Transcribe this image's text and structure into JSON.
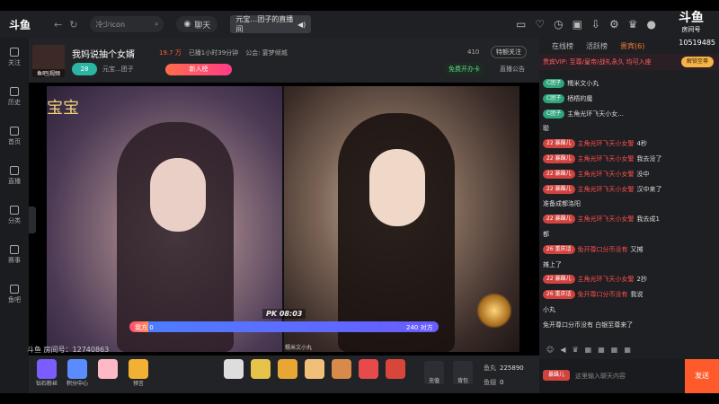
{
  "topbar": {
    "logo": "斗鱼",
    "search_placeholder": "冷少icon",
    "chat_label": "聊天",
    "tab_label": "元宝…团子的直播间",
    "brand": "斗鱼",
    "brand_sub": "房间号",
    "room_number": "10519485"
  },
  "sidebar": {
    "items": [
      {
        "label": "关注",
        "icon": "plus-icon"
      },
      {
        "label": "历史",
        "icon": "clock-icon"
      },
      {
        "label": "首页",
        "icon": "home-icon"
      },
      {
        "label": "直播",
        "icon": "tv-icon"
      },
      {
        "label": "分类",
        "icon": "grid-icon"
      },
      {
        "label": "赛事",
        "icon": "trophy-icon"
      },
      {
        "label": "鱼吧",
        "icon": "bubble-icon"
      }
    ]
  },
  "room": {
    "avatar_caption": "鱼吧|视频",
    "title": "我妈说抽个女婿",
    "hot": "19.7 万",
    "duration": "已播1小时39分钟",
    "notice_meta": "公会: 宴梦倾城",
    "level": "28",
    "host": "元宝...团子",
    "new_rank": "新人榜",
    "count": "410",
    "follow": "特额关注",
    "free_card": "免费开办卡",
    "announcement": "直播公告"
  },
  "video": {
    "overlay_text": "宝宝",
    "pk_label": "PK",
    "pk_time": "08:03",
    "our_side": "我方 0",
    "their_side": "240 对方",
    "our_fraction": 0.06,
    "right_name": "糯米文小丸",
    "douyu_id": "斗鱼 房间号：12740863"
  },
  "gifts": {
    "left": [
      {
        "label": "钻石粉丝",
        "color": "#7a5cff"
      },
      {
        "label": "积分中心",
        "color": "#5b8cff"
      },
      {
        "label": "",
        "color": "#ffb8c6"
      },
      {
        "label": "预言",
        "color": "#f2b134"
      }
    ],
    "middle": [
      {
        "label": "",
        "color": "#dddddd"
      },
      {
        "label": "",
        "color": "#e6c34a"
      },
      {
        "label": "",
        "color": "#e8a735"
      },
      {
        "label": "",
        "color": "#f0c07a"
      },
      {
        "label": "",
        "color": "#d88a4a"
      },
      {
        "label": "",
        "color": "#e64a4a"
      },
      {
        "label": "",
        "color": "#d8453a"
      }
    ],
    "recharge": "充值",
    "backpack": "背包",
    "fish_pill_label": "鱼丸",
    "fish_pill_value": "225890",
    "fish_fin_label": "鱼翅",
    "fish_fin_value": "0"
  },
  "chat": {
    "tabs": [
      "在线榜",
      "活跃榜",
      "贵宾(6)"
    ],
    "vip_banner": "贵宾VIP: 至尊/皇帝/战礼永久 均可入座",
    "unlock": "解锁至尊",
    "messages": [
      {
        "badge": "C团子",
        "text": "糯米文小丸"
      },
      {
        "badge": "C团子",
        "text": "栖梧的魔"
      },
      {
        "badge": "C团子",
        "text": "主角光环飞天小女..."
      },
      {
        "badge": "",
        "text": "聪"
      },
      {
        "badge": "22 暴躁儿",
        "text": "4秒",
        "name": "主角光环飞天小女警"
      },
      {
        "badge": "22 暴躁儿",
        "text": "我去没了",
        "name": "主角光环飞天小女警"
      },
      {
        "badge": "22 暴躁儿",
        "text": "没中",
        "name": "主角光环飞天小女警"
      },
      {
        "badge": "22 暴躁儿",
        "text": "汉中来了",
        "name": "主角光环飞天小女警"
      },
      {
        "badge": "",
        "text": "准备成都洛阳"
      },
      {
        "badge": "22 暴躁儿",
        "text": "我去成1",
        "name": "主角光环飞天小女警"
      },
      {
        "badge": "",
        "text": "都"
      },
      {
        "badge": "26 重庆话",
        "text": "又摊",
        "name": "免开尊口分币没有"
      },
      {
        "badge": "",
        "text": "摊上了"
      },
      {
        "badge": "22 暴躁儿",
        "text": "2抄",
        "name": "主角光环飞天小女警"
      },
      {
        "badge": "26 重庆话",
        "text": "我说",
        "name": "免开尊口分币没有"
      },
      {
        "badge": "",
        "text": "小丸"
      },
      {
        "badge": "",
        "text": "免开尊口分币没有 白银至尊来了"
      }
    ],
    "input_placeholder": "这里输入聊天内容",
    "send": "发送",
    "mini_badge": "暴躁儿"
  }
}
